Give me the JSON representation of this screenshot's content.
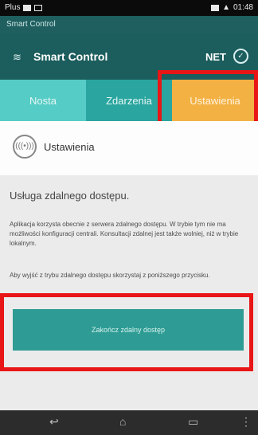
{
  "status": {
    "carrier": "Plus",
    "time": "01:48"
  },
  "window": {
    "title": "Smart Control"
  },
  "appbar": {
    "title": "Smart Control",
    "net": "NET",
    "ok": "✓"
  },
  "tabs": [
    {
      "label": "Nosta"
    },
    {
      "label": "Zdarzenia"
    },
    {
      "label": "Ustawienia"
    }
  ],
  "section": {
    "icon_text": "(((•)))",
    "title": "Ustawienia"
  },
  "content": {
    "heading": "Usługa zdalnego dostępu.",
    "paragraph1": "Aplikacja korzysta obecnie z serwera zdalnego dostępu. W trybie tym nie ma możliwości konfiguracji centrali. Konsultacji zdalnej jest także wolniej, niż w trybie lokalnym.",
    "paragraph2": "Aby wyjść z trybu zdalnego dostępu skorzystaj z poniższego przycisku.",
    "button_label": "Zakończ zdalny dostęp"
  },
  "navbar": {
    "back": "↩",
    "home": "⌂",
    "recent": "▭",
    "menu": "⋮"
  },
  "colors": {
    "accent": "#1c5d5d",
    "tab_active": "#f3b144",
    "highlight": "#e81616"
  }
}
